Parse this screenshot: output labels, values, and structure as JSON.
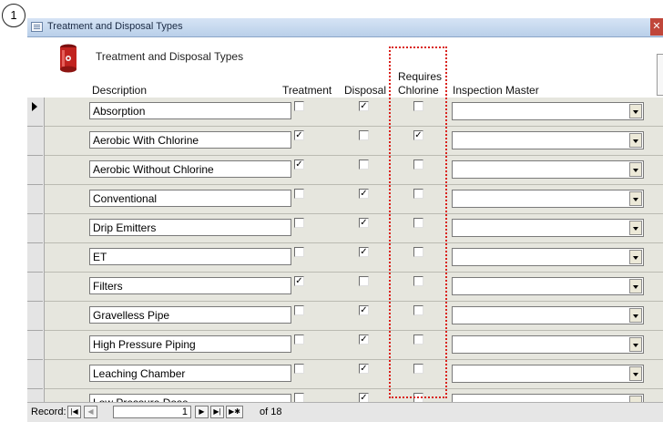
{
  "callout_number": "1",
  "window": {
    "title": "Treatment and Disposal Types",
    "close_glyph": "✕"
  },
  "form": {
    "title": "Treatment and Disposal Types",
    "headers": {
      "description": "Description",
      "treatment": "Treatment",
      "disposal": "Disposal",
      "requires_line1": "Requires",
      "requires_line2": "Chlorine",
      "inspection_master": "Inspection Master"
    }
  },
  "rows": [
    {
      "description": "Absorption",
      "treatment": false,
      "disposal": true,
      "requires_chlorine": false,
      "inspection_master": "",
      "current": true
    },
    {
      "description": "Aerobic With Chlorine",
      "treatment": true,
      "disposal": false,
      "requires_chlorine": true,
      "inspection_master": ""
    },
    {
      "description": "Aerobic Without Chlorine",
      "treatment": true,
      "disposal": false,
      "requires_chlorine": false,
      "inspection_master": ""
    },
    {
      "description": "Conventional",
      "treatment": false,
      "disposal": true,
      "requires_chlorine": false,
      "inspection_master": ""
    },
    {
      "description": "Drip Emitters",
      "treatment": false,
      "disposal": true,
      "requires_chlorine": false,
      "inspection_master": ""
    },
    {
      "description": "ET",
      "treatment": false,
      "disposal": true,
      "requires_chlorine": false,
      "inspection_master": ""
    },
    {
      "description": "Filters",
      "treatment": true,
      "disposal": false,
      "requires_chlorine": false,
      "inspection_master": ""
    },
    {
      "description": "Gravelless Pipe",
      "treatment": false,
      "disposal": true,
      "requires_chlorine": false,
      "inspection_master": ""
    },
    {
      "description": "High Pressure Piping",
      "treatment": false,
      "disposal": true,
      "requires_chlorine": false,
      "inspection_master": ""
    },
    {
      "description": "Leaching Chamber",
      "treatment": false,
      "disposal": true,
      "requires_chlorine": false,
      "inspection_master": ""
    },
    {
      "description": "Low Pressure Dose",
      "treatment": false,
      "disposal": true,
      "requires_chlorine": false,
      "inspection_master": ""
    }
  ],
  "navigation": {
    "record_label": "Record:",
    "current_record": "1",
    "of_label": "of 18",
    "buttons": {
      "first": "|◀",
      "prev": "◀",
      "next": "▶",
      "last": "▶|",
      "new": "▶✱"
    }
  },
  "colors": {
    "highlight_border": "#d9201a",
    "title_bar": "#c6d9f0",
    "row_background": "#e6e6de"
  },
  "icons": {
    "form_logo": "septic-tank-icon",
    "window_icon": "form-window-icon"
  }
}
